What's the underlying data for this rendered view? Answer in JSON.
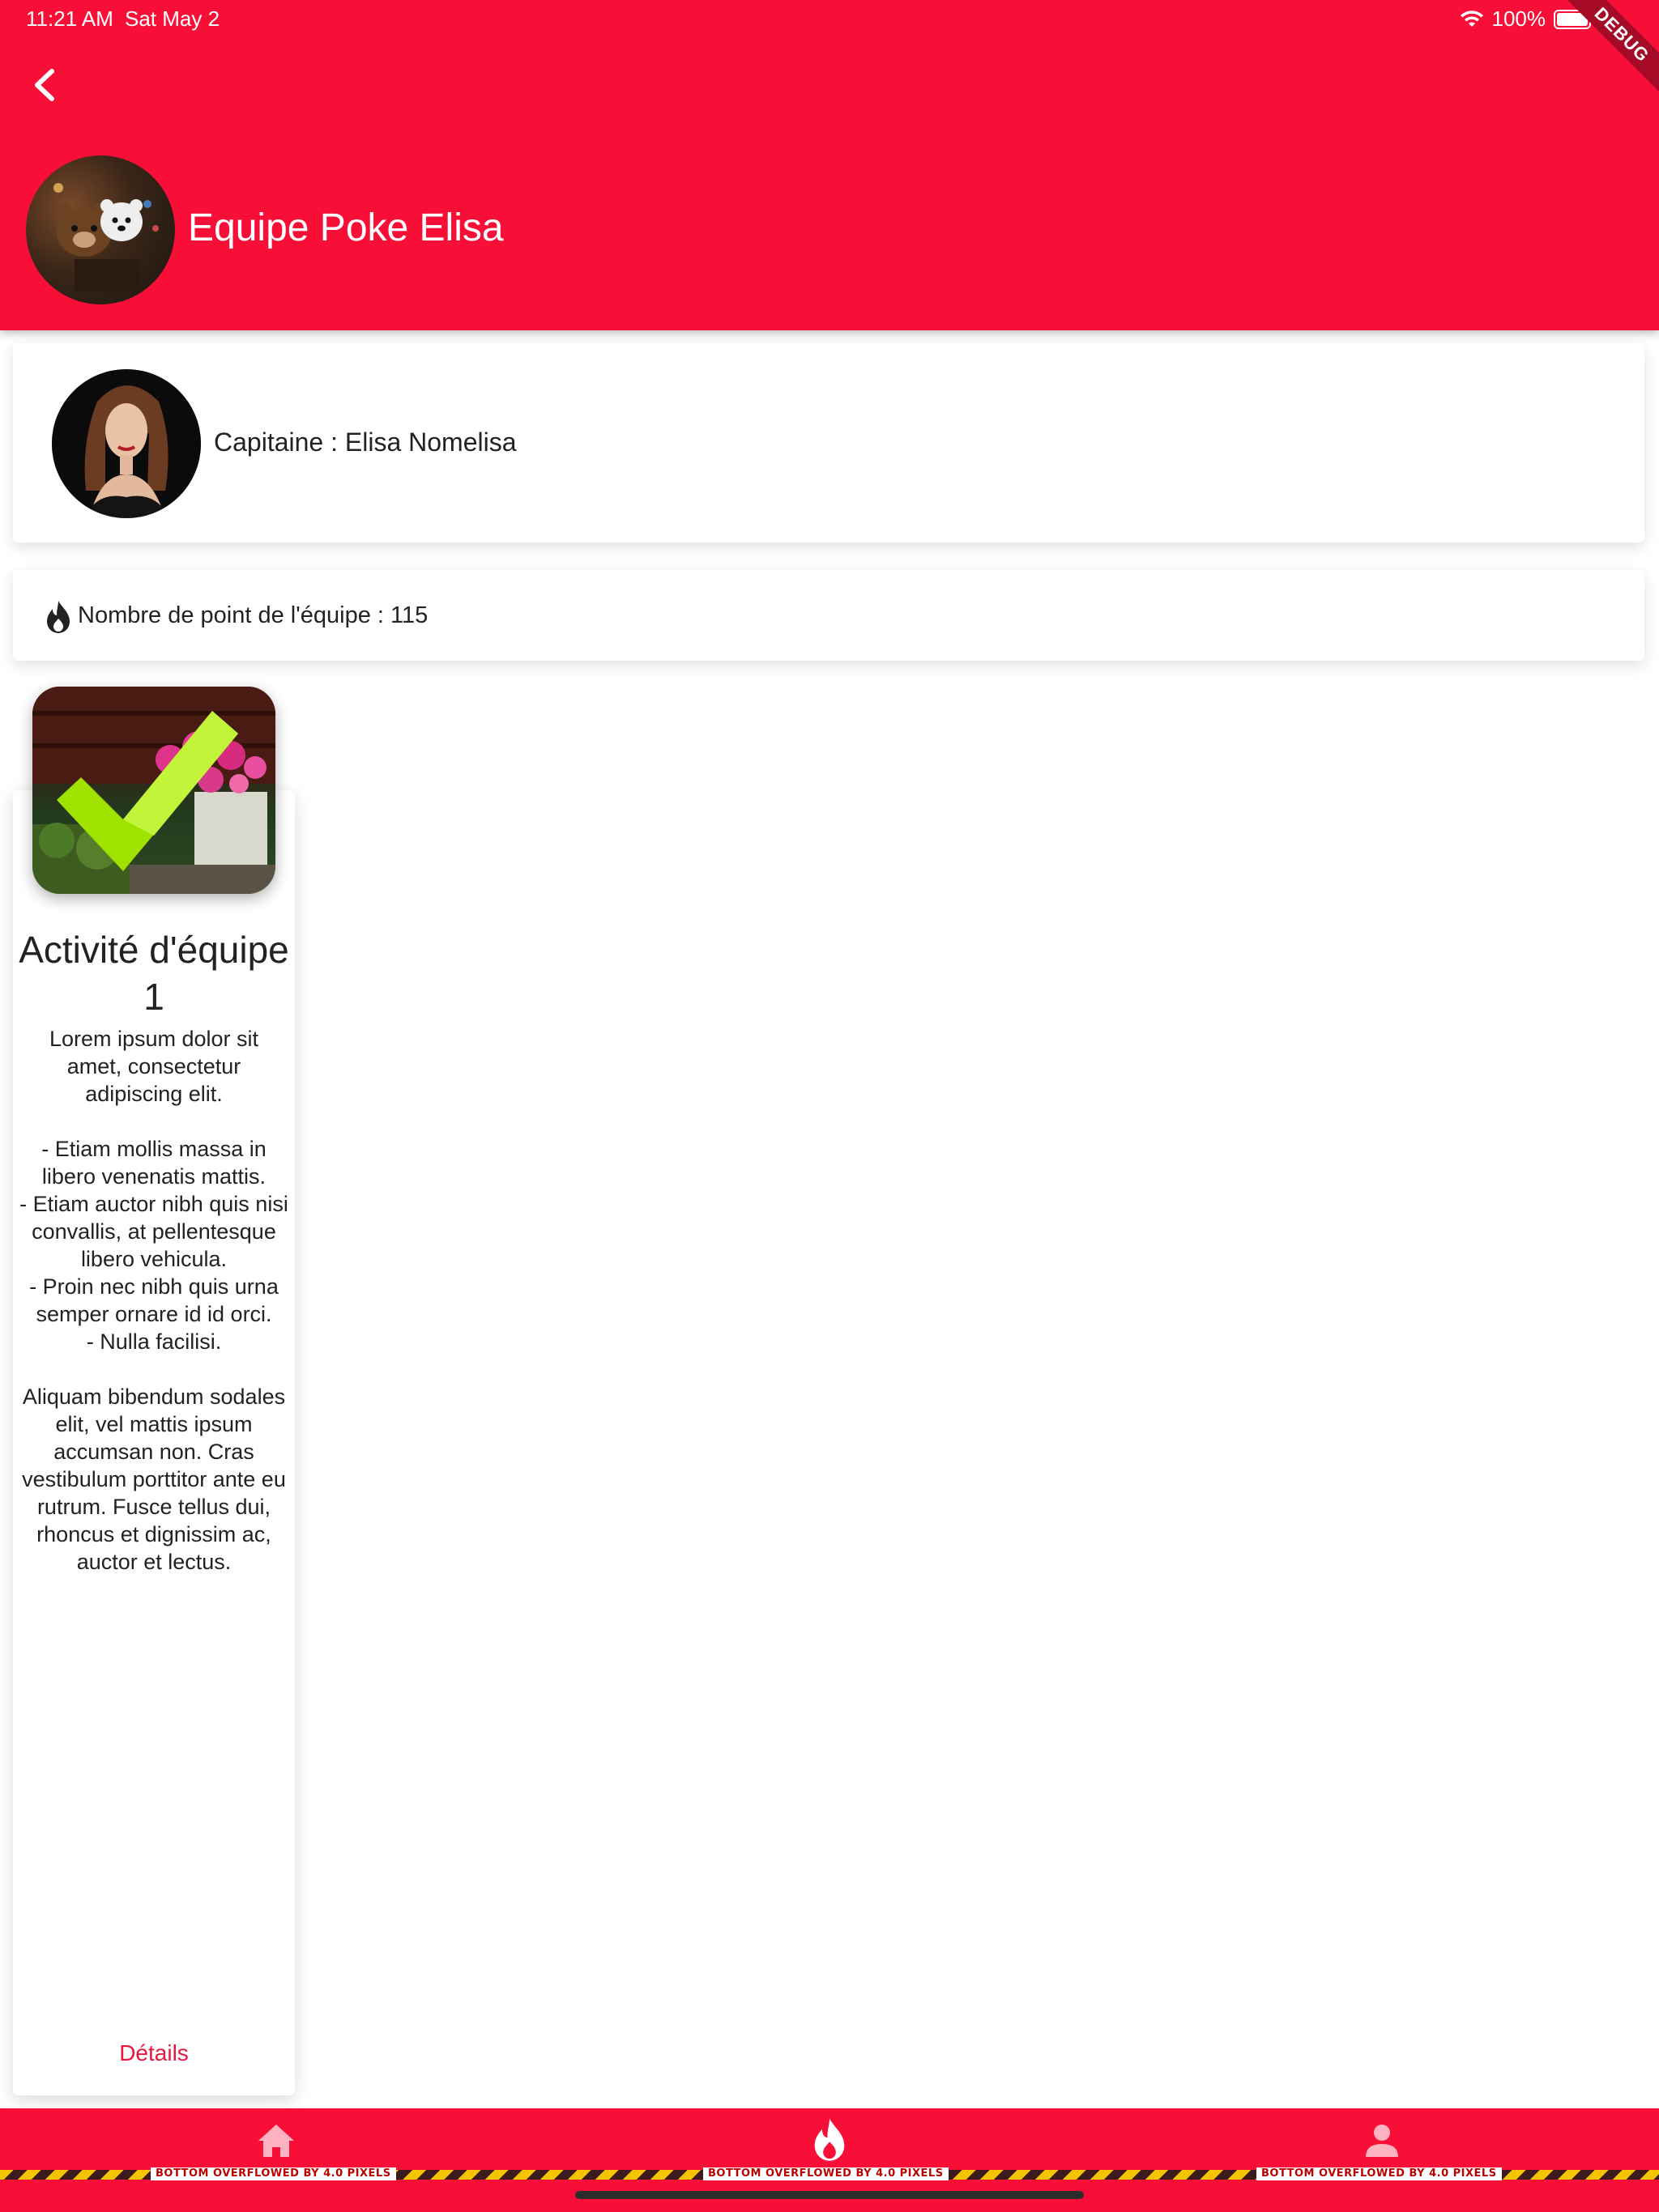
{
  "status_bar": {
    "time": "11:21 AM",
    "date": "Sat May 2",
    "battery": "100%",
    "debug_label": "DEBUG"
  },
  "header": {
    "team_name": "Equipe Poke Elisa",
    "back_icon": "chevron-left-icon"
  },
  "captain": {
    "label": "Capitaine : Elisa Nomelisa"
  },
  "points": {
    "icon": "flame-icon",
    "label": "Nombre de point de l'équipe : 115"
  },
  "activity": {
    "title": "Activité d'équipe 1",
    "description": "Lorem ipsum dolor sit amet, consectetur adipiscing elit.\n\n- Etiam mollis massa in libero venenatis mattis.\n- Etiam auctor nibh quis nisi convallis, at pellentesque libero vehicula.\n- Proin nec nibh quis urna semper ornare id id orci.\n- Nulla facilisi.\n\nAliquam bibendum sodales elit, vel mattis ipsum accumsan non. Cras vestibulum porttitor ante eu rutrum. Fusce tellus dui, rhoncus et dignissim ac, auctor et lectus.",
    "details_label": "Détails"
  },
  "bottom_nav": {
    "items": [
      {
        "icon": "home-icon"
      },
      {
        "icon": "flame-icon"
      },
      {
        "icon": "person-icon"
      }
    ],
    "overflow_message": "BOTTOM OVERFLOWED BY 4.0 PIXELS"
  },
  "colors": {
    "primary": "#f70f37",
    "accent_text": "#e8173e",
    "check_green": "#9fe200"
  }
}
